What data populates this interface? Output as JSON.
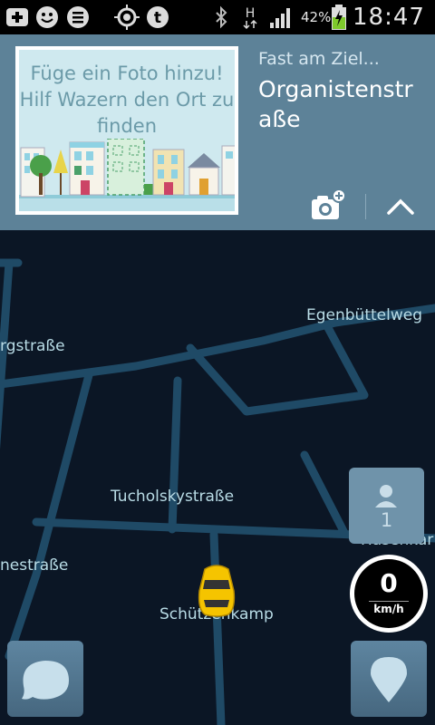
{
  "status_bar": {
    "battery_percent": "42%",
    "time": "18:47",
    "network_type": "H",
    "icons": [
      "plus-icon",
      "waze-icon",
      "list-icon",
      "gps-icon",
      "tumblr-icon",
      "bluetooth-icon",
      "network-h-icon",
      "signal-icon",
      "battery-charging-icon"
    ]
  },
  "top_panel": {
    "add_photo_prompt": "Füge ein Foto hinzu! Hilf Wazern den Ort zu finden",
    "destination_prefix": "Fast am Ziel...",
    "destination_name": "Organistenstraße",
    "camera_icon": "camera-add-icon",
    "collapse_icon": "chevron-up-icon"
  },
  "map": {
    "streets": {
      "egenbuettelweg": "Egenbüttelweg",
      "rgstrasse": "rgstraße",
      "tucholskystrasse": "Tucholskystraße",
      "nestrasse": "nestraße",
      "schuetzenkamp": "Schützenkamp",
      "hasenkamp": "Hasenkar"
    },
    "users_nearby": "1",
    "speed": {
      "value": "0",
      "unit": "km/h"
    },
    "colors": {
      "background": "#0b1625",
      "road": "#1f4a66",
      "label": "#b9dce6"
    }
  },
  "buttons": {
    "menu_icon": "waze-menu-icon",
    "report_icon": "map-pin-icon"
  }
}
